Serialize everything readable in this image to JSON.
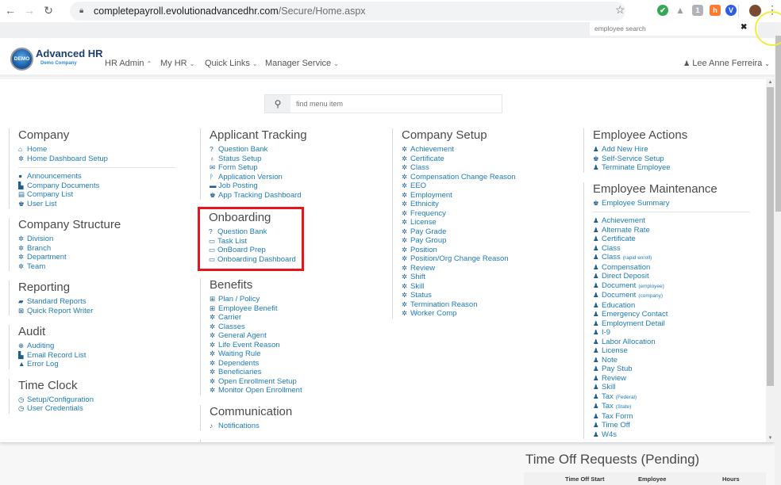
{
  "browser": {
    "url_domain": "completepayroll.evolutionadvancedhr.com",
    "url_path": "/Secure/Home.aspx",
    "extensions": [
      {
        "name": "check-extension",
        "color": "#34a853",
        "glyph": "✔"
      },
      {
        "name": "drive-extension",
        "color": "#9aa0a6",
        "glyph": "▲"
      },
      {
        "name": "translate-extension",
        "color": "#b0b4b8",
        "glyph": "1"
      },
      {
        "name": "hubspot-extension",
        "color": "#ff7a2f",
        "glyph": "h"
      },
      {
        "name": "v-extension",
        "color": "#2f5fe0",
        "glyph": "V"
      }
    ]
  },
  "employee_search": {
    "placeholder": "employee search",
    "clear": "✖"
  },
  "header": {
    "brand": "Advanced HR",
    "company": "Demo Company",
    "logo_text": "DEMO",
    "nav": [
      {
        "label": "HR Admin",
        "chevron": "⌃"
      },
      {
        "label": "My HR",
        "chevron": "⌄"
      },
      {
        "label": "Quick Links",
        "chevron": "⌄"
      },
      {
        "label": "Manager Service",
        "chevron": "⌄"
      }
    ],
    "user": "Lee Anne Ferreira"
  },
  "menu_search": {
    "placeholder": "find menu item"
  },
  "columns": {
    "company": {
      "title": "Company",
      "group1": [
        {
          "icon": "home-icon",
          "glyph": "⌂",
          "label": "Home"
        },
        {
          "icon": "gear-icon",
          "glyph": "✲",
          "label": "Home Dashboard Setup"
        }
      ],
      "group2": [
        {
          "icon": "comment-icon",
          "glyph": "●",
          "label": "Announcements"
        },
        {
          "icon": "file-icon",
          "glyph": "▙",
          "label": "Company Documents"
        },
        {
          "icon": "building-icon",
          "glyph": "▤",
          "label": "Company List"
        },
        {
          "icon": "users-icon",
          "glyph": "♚",
          "label": "User List"
        }
      ]
    },
    "company_structure": {
      "title": "Company Structure",
      "items": [
        {
          "icon": "gear-icon",
          "glyph": "✲",
          "label": "Division"
        },
        {
          "icon": "gear-icon",
          "glyph": "✲",
          "label": "Branch"
        },
        {
          "icon": "gear-icon",
          "glyph": "✲",
          "label": "Department"
        },
        {
          "icon": "gear-icon",
          "glyph": "✲",
          "label": "Team"
        }
      ]
    },
    "reporting": {
      "title": "Reporting",
      "items": [
        {
          "icon": "book-icon",
          "glyph": "▰",
          "label": "Standard Reports"
        },
        {
          "icon": "excel-file-icon",
          "glyph": "⊠",
          "label": "Quick Report Writer"
        }
      ]
    },
    "audit": {
      "title": "Audit",
      "items": [
        {
          "icon": "search-plus-icon",
          "glyph": "⊕",
          "label": "Auditing"
        },
        {
          "icon": "file-icon",
          "glyph": "▙",
          "label": "Email Record List"
        },
        {
          "icon": "warning-icon",
          "glyph": "▲",
          "label": "Error Log"
        }
      ]
    },
    "time_clock": {
      "title": "Time Clock",
      "items": [
        {
          "icon": "clock-icon",
          "glyph": "◷",
          "label": "Setup/Configuration"
        },
        {
          "icon": "clock-icon",
          "glyph": "◷",
          "label": "User Credentials"
        }
      ]
    },
    "applicant_tracking": {
      "title": "Applicant Tracking",
      "items": [
        {
          "icon": "question-icon",
          "glyph": "?",
          "label": "Question Bank"
        },
        {
          "icon": "stethoscope-icon",
          "glyph": "♁",
          "label": "Status Setup"
        },
        {
          "icon": "envelope-icon",
          "glyph": "✉",
          "label": "Form Setup"
        },
        {
          "icon": "code-fork-icon",
          "glyph": "ᚹ",
          "label": "Application Version"
        },
        {
          "icon": "briefcase-icon",
          "glyph": "▬",
          "label": "Job Posting"
        },
        {
          "icon": "users-icon",
          "glyph": "♚",
          "label": "App Tracking Dashboard"
        }
      ]
    },
    "onboarding": {
      "title": "Onboarding",
      "items": [
        {
          "icon": "question-icon",
          "glyph": "?",
          "label": "Question Bank"
        },
        {
          "icon": "desktop-icon",
          "glyph": "▭",
          "label": "Task List"
        },
        {
          "icon": "desktop-icon",
          "glyph": "▭",
          "label": "OnBoard Prep"
        },
        {
          "icon": "desktop-icon",
          "glyph": "▭",
          "label": "Onboarding Dashboard"
        }
      ]
    },
    "benefits": {
      "title": "Benefits",
      "items": [
        {
          "icon": "medkit-icon",
          "glyph": "⊞",
          "label": "Plan / Policy"
        },
        {
          "icon": "medkit-icon",
          "glyph": "⊞",
          "label": "Employee Benefit"
        },
        {
          "icon": "gear-icon",
          "glyph": "✲",
          "label": "Carrier"
        },
        {
          "icon": "gear-icon",
          "glyph": "✲",
          "label": "Classes"
        },
        {
          "icon": "gear-icon",
          "glyph": "✲",
          "label": "General Agent"
        },
        {
          "icon": "gear-icon",
          "glyph": "✲",
          "label": "Life Event Reason"
        },
        {
          "icon": "gear-icon",
          "glyph": "✲",
          "label": "Waiting Rule"
        },
        {
          "icon": "gear-icon",
          "glyph": "✲",
          "label": "Dependents"
        },
        {
          "icon": "gear-icon",
          "glyph": "✲",
          "label": "Beneficiaries"
        },
        {
          "icon": "gear-icon",
          "glyph": "✲",
          "label": "Open Enrollment Setup"
        },
        {
          "icon": "gear-icon",
          "glyph": "✲",
          "label": "Monitor Open Enrollment"
        }
      ]
    },
    "communication": {
      "title": "Communication",
      "items": [
        {
          "icon": "bell-icon",
          "glyph": "♪",
          "label": "Notifications"
        }
      ]
    },
    "company_setup": {
      "title": "Company Setup",
      "items": [
        {
          "icon": "gear-icon",
          "glyph": "✲",
          "label": "Achievement"
        },
        {
          "icon": "gear-icon",
          "glyph": "✲",
          "label": "Certificate"
        },
        {
          "icon": "gear-icon",
          "glyph": "✲",
          "label": "Class"
        },
        {
          "icon": "gear-icon",
          "glyph": "✲",
          "label": "Compensation Change Reason"
        },
        {
          "icon": "gear-icon",
          "glyph": "✲",
          "label": "EEO"
        },
        {
          "icon": "gear-icon",
          "glyph": "✲",
          "label": "Employment"
        },
        {
          "icon": "gear-icon",
          "glyph": "✲",
          "label": "Ethnicity"
        },
        {
          "icon": "gear-icon",
          "glyph": "✲",
          "label": "Frequency"
        },
        {
          "icon": "gear-icon",
          "glyph": "✲",
          "label": "License"
        },
        {
          "icon": "gear-icon",
          "glyph": "✲",
          "label": "Pay Grade"
        },
        {
          "icon": "gear-icon",
          "glyph": "✲",
          "label": "Pay Group"
        },
        {
          "icon": "gear-icon",
          "glyph": "✲",
          "label": "Position"
        },
        {
          "icon": "gear-icon",
          "glyph": "✲",
          "label": "Position/Org Change Reason"
        },
        {
          "icon": "gear-icon",
          "glyph": "✲",
          "label": "Review"
        },
        {
          "icon": "gear-icon",
          "glyph": "✲",
          "label": "Shift"
        },
        {
          "icon": "gear-icon",
          "glyph": "✲",
          "label": "Skill"
        },
        {
          "icon": "gear-icon",
          "glyph": "✲",
          "label": "Status"
        },
        {
          "icon": "gear-icon",
          "glyph": "✲",
          "label": "Termination Reason"
        },
        {
          "icon": "gear-icon",
          "glyph": "✲",
          "label": "Worker Comp"
        }
      ]
    },
    "employee_actions": {
      "title": "Employee Actions",
      "items": [
        {
          "icon": "user-plus-icon",
          "glyph": "♟",
          "label": "Add New Hire"
        },
        {
          "icon": "users-icon",
          "glyph": "♚",
          "label": "Self-Service Setup"
        },
        {
          "icon": "user-times-icon",
          "glyph": "♟",
          "label": "Terminate Employee"
        }
      ]
    },
    "employee_maintenance": {
      "title": "Employee Maintenance",
      "summary": {
        "icon": "users-icon",
        "glyph": "♚",
        "label": "Employee Summary"
      },
      "items": [
        {
          "label": "Achievement",
          "note": ""
        },
        {
          "label": "Alternate Rate",
          "note": ""
        },
        {
          "label": "Certificate",
          "note": ""
        },
        {
          "label": "Class",
          "note": ""
        },
        {
          "label": "Class",
          "note": "(rapid enroll)"
        },
        {
          "label": "Compensation",
          "note": ""
        },
        {
          "label": "Direct Deposit",
          "note": ""
        },
        {
          "label": "Document",
          "note": "(employee)"
        },
        {
          "label": "Document",
          "note": "(company)"
        },
        {
          "label": "Education",
          "note": ""
        },
        {
          "label": "Emergency Contact",
          "note": ""
        },
        {
          "label": "Employment Detail",
          "note": ""
        },
        {
          "label": "I-9",
          "note": ""
        },
        {
          "label": "Labor Allocation",
          "note": ""
        },
        {
          "label": "License",
          "note": ""
        },
        {
          "label": "Note",
          "note": ""
        },
        {
          "label": "Pay Stub",
          "note": ""
        },
        {
          "label": "Review",
          "note": ""
        },
        {
          "label": "Skill",
          "note": ""
        },
        {
          "label": "Tax",
          "note": "(Federal)"
        },
        {
          "label": "Tax",
          "note": "(State)"
        },
        {
          "label": "Tax Form",
          "note": ""
        },
        {
          "label": "Time Off",
          "note": ""
        },
        {
          "label": "W4s",
          "note": ""
        }
      ],
      "item_glyph": "♟"
    }
  },
  "time_off": {
    "title": "Time Off Requests (Pending)",
    "columns": [
      "Time Off Start",
      "Employee",
      "Hours"
    ]
  },
  "colors": {
    "link": "#1f7bb5",
    "highlight": "#e8141b",
    "brand": "#1d3d73"
  }
}
